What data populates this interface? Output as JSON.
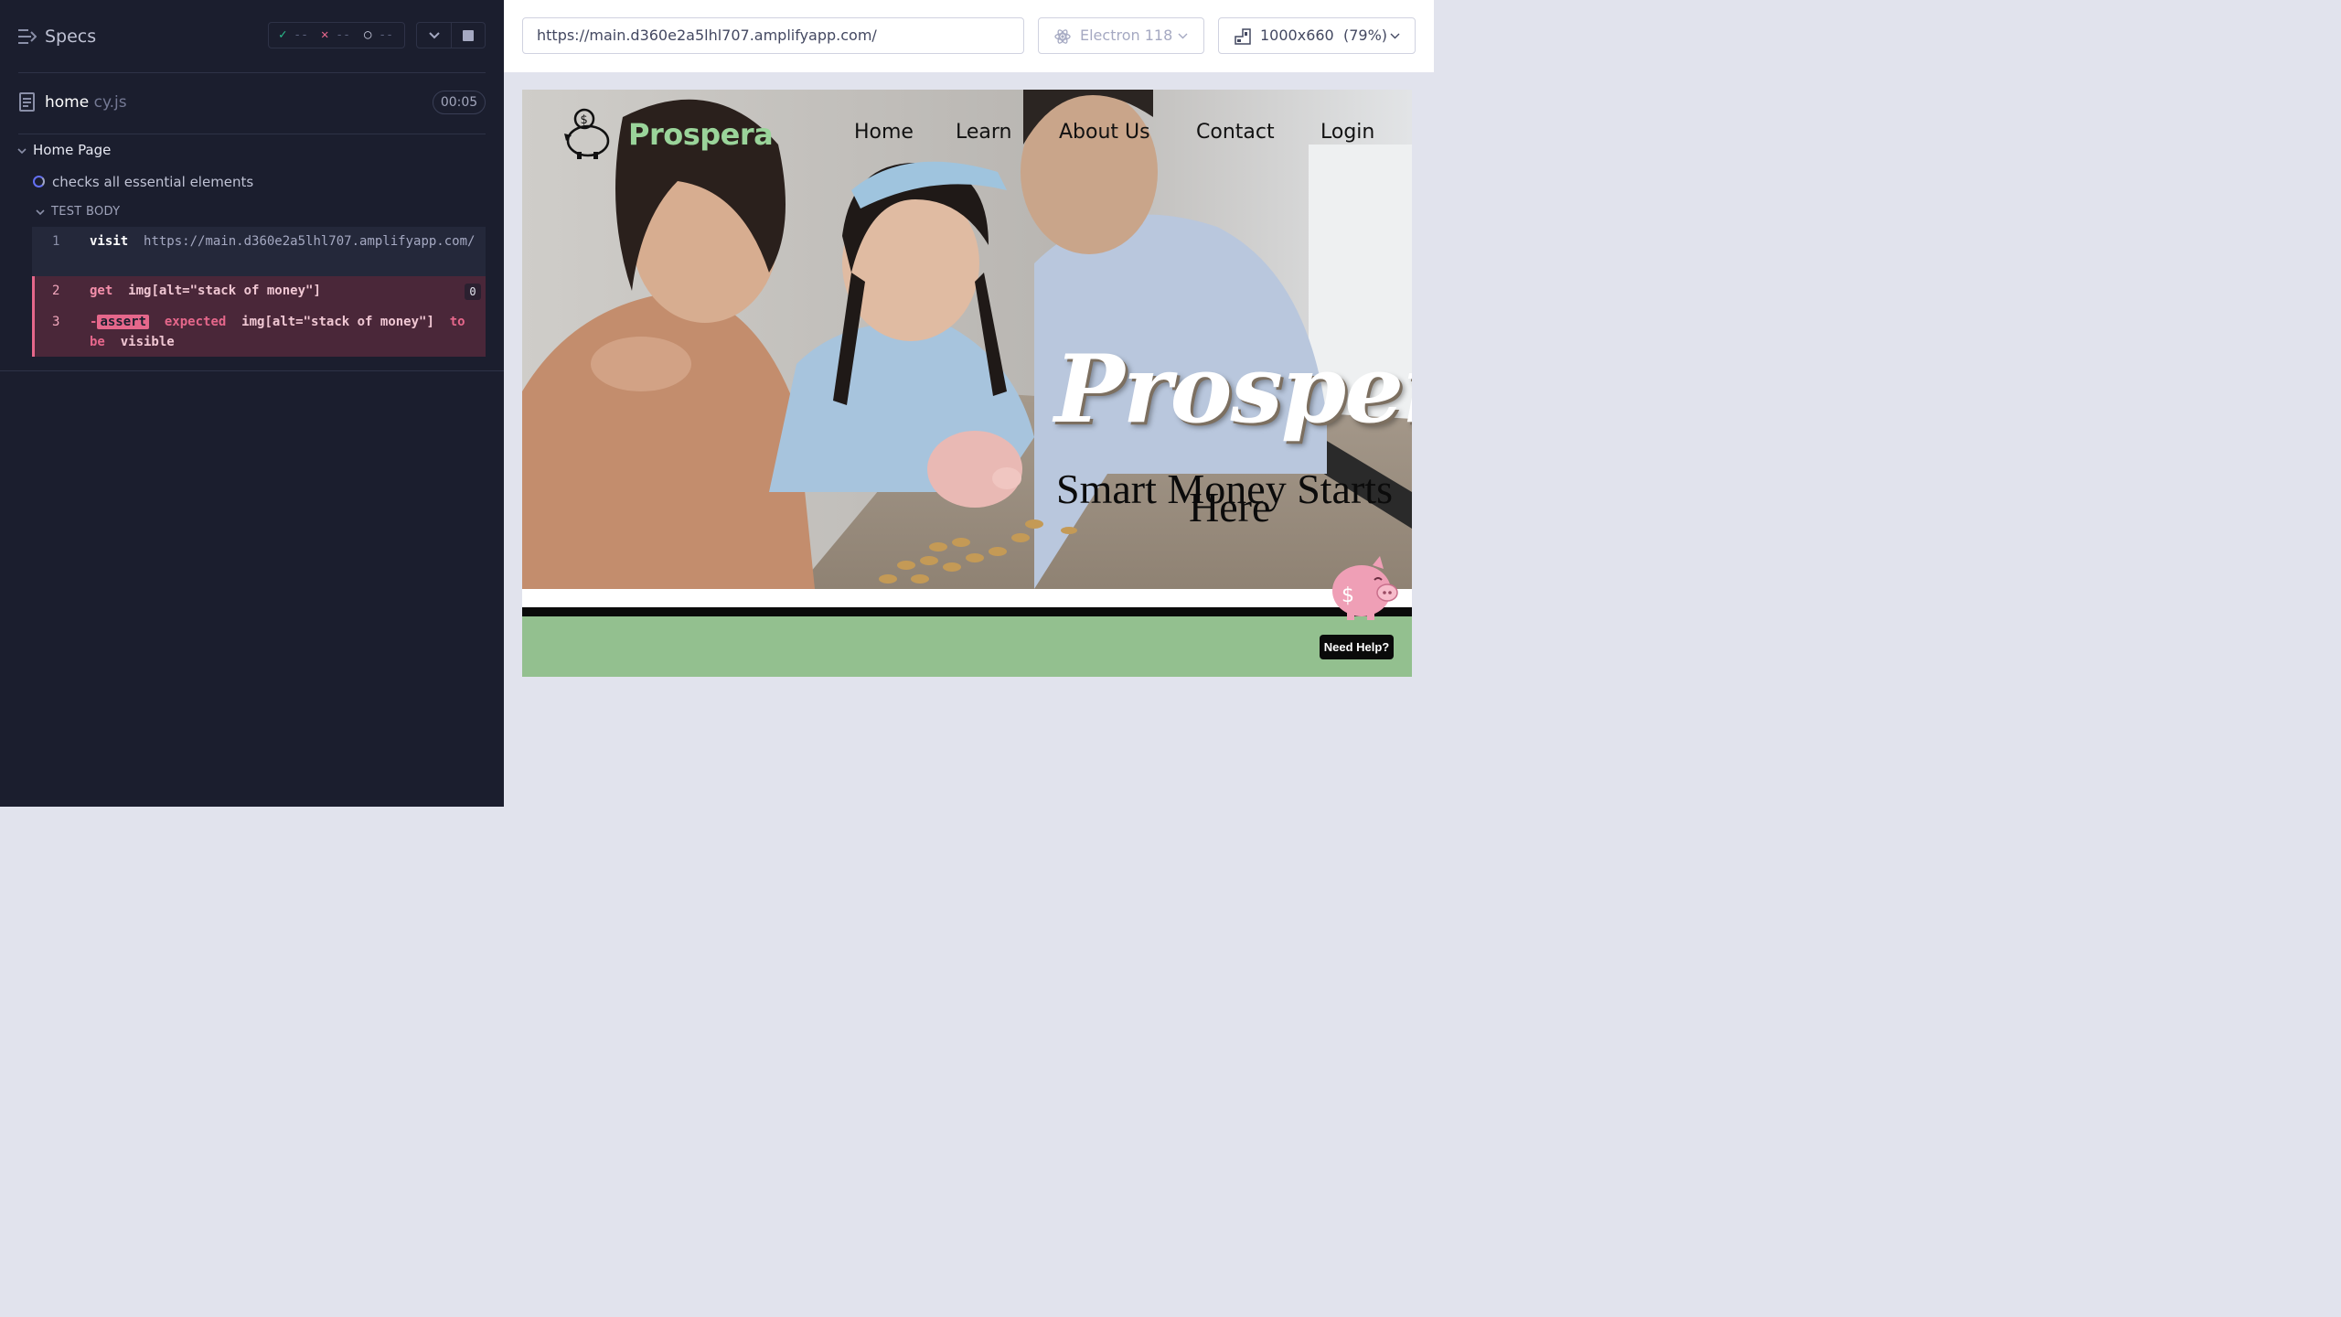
{
  "reporter": {
    "header_title": "Specs",
    "stats": {
      "passed": "--",
      "failed": "--",
      "pending": "--"
    },
    "spec": {
      "name": "home",
      "ext": " cy.js",
      "duration": "00:05"
    },
    "suite": "Home Page",
    "test": "checks all essential elements",
    "test_body_label": "TEST BODY",
    "commands": [
      {
        "num": "1",
        "keyword": "visit",
        "arg": "https://main.d360e2a5lhl707.amplifyapp.com/"
      },
      {
        "num": "2",
        "keyword": "get",
        "arg": "img[alt=\"stack of money\"]",
        "badge": "0"
      },
      {
        "num": "3",
        "prefix": "-",
        "keyword": "assert",
        "expected": "expected",
        "arg": "img[alt=\"stack of money\"]",
        "to": "to",
        "be": "be",
        "visible": "visible"
      }
    ]
  },
  "aut": {
    "url": "https://main.d360e2a5lhl707.amplifyapp.com/",
    "browser": "Electron 118",
    "viewport": "1000x660",
    "scale": "(79%)"
  },
  "app": {
    "brand": "Prospera",
    "nav": [
      "Home",
      "Learn",
      "About Us",
      "Contact",
      "Login"
    ],
    "hero_title": "Prospera",
    "hero_sub_line1": "Smart Money Starts",
    "hero_sub_line2": "Here",
    "help_button": "Need Help?",
    "colors": {
      "brand_green": "#9ad49a",
      "band_green": "#93c08f",
      "fail_pink": "#e5678b",
      "reporter_bg": "#1b1e2e"
    }
  }
}
